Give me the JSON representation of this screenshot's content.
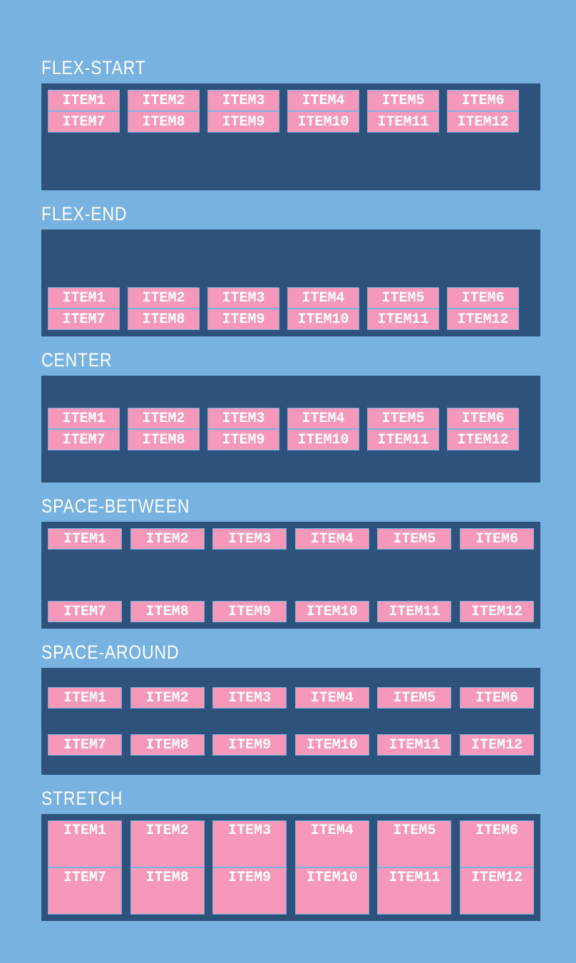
{
  "sections": [
    {
      "title": "FLEX-START",
      "mode": "flex-start",
      "items": [
        "ITEM1",
        "ITEM2",
        "ITEM3",
        "ITEM4",
        "ITEM5",
        "ITEM6",
        "ITEM7",
        "ITEM8",
        "ITEM9",
        "ITEM10",
        "ITEM11",
        "ITEM12"
      ]
    },
    {
      "title": "FLEX-END",
      "mode": "flex-end",
      "items": [
        "ITEM1",
        "ITEM2",
        "ITEM3",
        "ITEM4",
        "ITEM5",
        "ITEM6",
        "ITEM7",
        "ITEM8",
        "ITEM9",
        "ITEM10",
        "ITEM11",
        "ITEM12"
      ]
    },
    {
      "title": "CENTER",
      "mode": "center",
      "items": [
        "ITEM1",
        "ITEM2",
        "ITEM3",
        "ITEM4",
        "ITEM5",
        "ITEM6",
        "ITEM7",
        "ITEM8",
        "ITEM9",
        "ITEM10",
        "ITEM11",
        "ITEM12"
      ]
    },
    {
      "title": "SPACE-BETWEEN",
      "mode": "space-between",
      "items": [
        "ITEM1",
        "ITEM2",
        "ITEM3",
        "ITEM4",
        "ITEM5",
        "ITEM6",
        "ITEM7",
        "ITEM8",
        "ITEM9",
        "ITEM10",
        "ITEM11",
        "ITEM12"
      ]
    },
    {
      "title": "SPACE-AROUND",
      "mode": "space-around",
      "items": [
        "ITEM1",
        "ITEM2",
        "ITEM3",
        "ITEM4",
        "ITEM5",
        "ITEM6",
        "ITEM7",
        "ITEM8",
        "ITEM9",
        "ITEM10",
        "ITEM11",
        "ITEM12"
      ]
    },
    {
      "title": "STRETCH",
      "mode": "stretch",
      "items": [
        "ITEM1",
        "ITEM2",
        "ITEM3",
        "ITEM4",
        "ITEM5",
        "ITEM6",
        "ITEM7",
        "ITEM8",
        "ITEM9",
        "ITEM10",
        "ITEM11",
        "ITEM12"
      ]
    }
  ]
}
